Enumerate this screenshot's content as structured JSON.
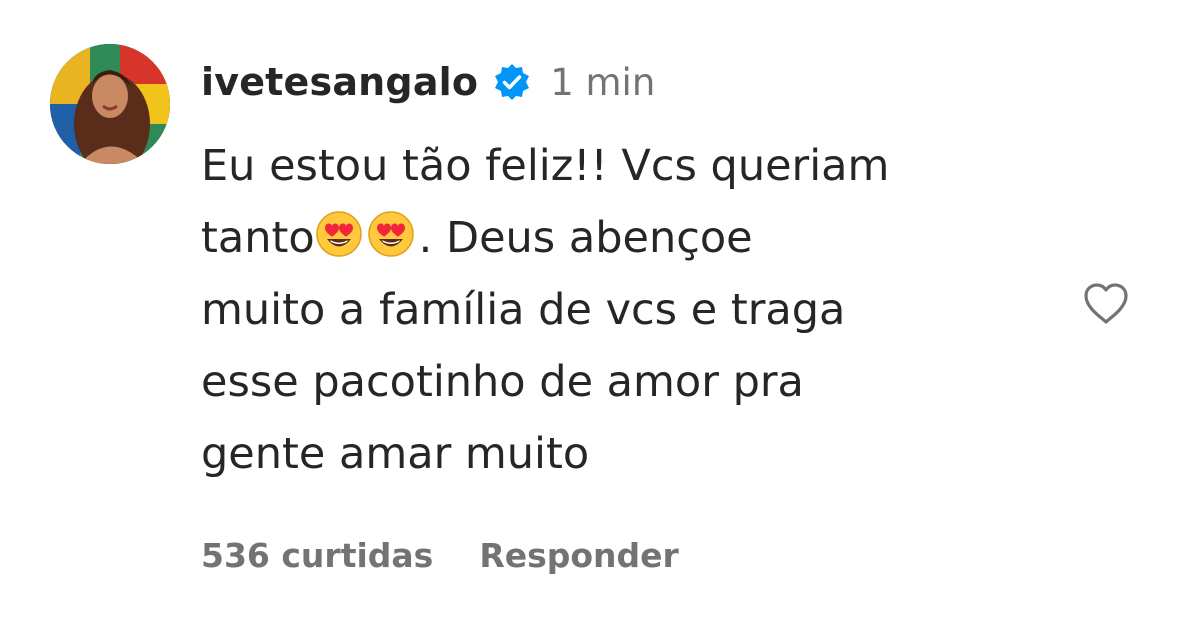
{
  "comment": {
    "username": "ivetesangalo",
    "verified": true,
    "timestamp": "1 min",
    "text_line1": "Eu estou tão feliz!! Vcs queriam",
    "text_line2_before": "tanto",
    "text_line2_after": ". Deus abençoe",
    "text_rest": "muito a família de vcs e traga\nesse pacotinho de amor pra\ngente amar muito",
    "emoji": "heart-eyes",
    "emoji_count": 2,
    "likes": "536 curtidas",
    "reply_label": "Responder",
    "like_icon": "heart-outline-icon"
  },
  "colors": {
    "verified_blue": "#0095f6",
    "secondary_text": "#737373",
    "primary_text": "#262626"
  }
}
